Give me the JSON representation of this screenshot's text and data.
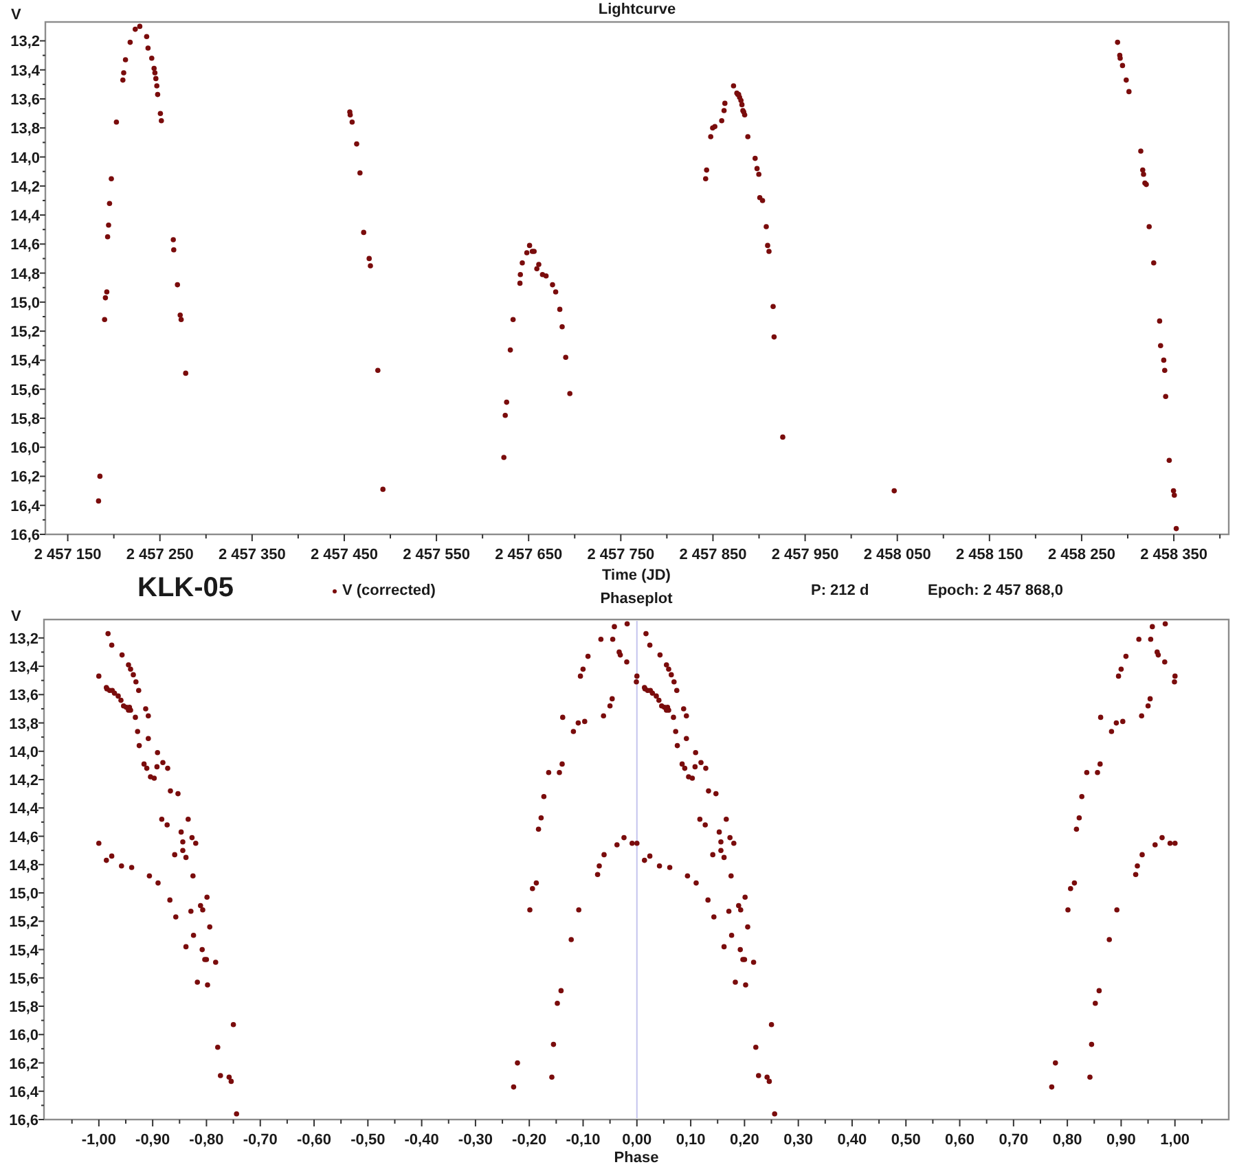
{
  "lightcurve": {
    "chart_data": {
      "type": "scatter",
      "title": "Lightcurve",
      "xlabel": "Time (JD)",
      "ylabel": "V",
      "xlim": [
        2457125.7,
        2458409.6
      ],
      "ylim": [
        16.6,
        13.07
      ],
      "xticks": [
        {
          "value": 2457150,
          "label": "2 457 150"
        },
        {
          "value": 2457250,
          "label": "2 457 250"
        },
        {
          "value": 2457350,
          "label": "2 457 350"
        },
        {
          "value": 2457450,
          "label": "2 457 450"
        },
        {
          "value": 2457550,
          "label": "2 457 550"
        },
        {
          "value": 2457650,
          "label": "2 457 650"
        },
        {
          "value": 2457750,
          "label": "2 457 750"
        },
        {
          "value": 2457850,
          "label": "2 457 850"
        },
        {
          "value": 2457950,
          "label": "2 457 950"
        },
        {
          "value": 2458050,
          "label": "2 458 050"
        },
        {
          "value": 2458150,
          "label": "2 458 150"
        },
        {
          "value": 2458250,
          "label": "2 458 250"
        },
        {
          "value": 2458350,
          "label": "2 458 350"
        }
      ],
      "yticks": [
        {
          "value": 13.2,
          "label": "13,2"
        },
        {
          "value": 13.4,
          "label": "13,4"
        },
        {
          "value": 13.6,
          "label": "13,6"
        },
        {
          "value": 13.8,
          "label": "13,8"
        },
        {
          "value": 14.0,
          "label": "14,0"
        },
        {
          "value": 14.2,
          "label": "14,2"
        },
        {
          "value": 14.4,
          "label": "14,4"
        },
        {
          "value": 14.6,
          "label": "14,6"
        },
        {
          "value": 14.8,
          "label": "14,8"
        },
        {
          "value": 15.0,
          "label": "15,0"
        },
        {
          "value": 15.2,
          "label": "15,2"
        },
        {
          "value": 15.4,
          "label": "15,4"
        },
        {
          "value": 15.6,
          "label": "15,6"
        },
        {
          "value": 15.8,
          "label": "15,8"
        },
        {
          "value": 16.0,
          "label": "16,0"
        },
        {
          "value": 16.2,
          "label": "16,2"
        },
        {
          "value": 16.4,
          "label": "16,4"
        },
        {
          "value": 16.6,
          "label": "16,6"
        }
      ],
      "series": [
        {
          "name": "V (corrected)",
          "color": "#7a0c0c",
          "x": [
            2457183.4,
            2457184.9,
            2457189.9,
            2457190.8,
            2457192.3,
            2457193.3,
            2457194.3,
            2457195.3,
            2457197.3,
            2457202.8,
            2457209.8,
            2457210.7,
            2457212.7,
            2457217.7,
            2457223.2,
            2457228.2,
            2457235.6,
            2457237.1,
            2457241.1,
            2457243.6,
            2457244.6,
            2457245.6,
            2457246.6,
            2457247.6,
            2457250.5,
            2457251.5,
            2457264.5,
            2457265.0,
            2457269.0,
            2457272.0,
            2457273.0,
            2457277.9,
            2457456.0,
            2457456.5,
            2457458.5,
            2457463.5,
            2457467.0,
            2457471.0,
            2457477.0,
            2457478.4,
            2457486.4,
            2457491.9,
            2457623.2,
            2457624.7,
            2457626.2,
            2457630.2,
            2457633.1,
            2457640.6,
            2457641.1,
            2457643.1,
            2457648.1,
            2457651.0,
            2457654.0,
            2457656.0,
            2457659.0,
            2457661.0,
            2457665.0,
            2457668.9,
            2457675.9,
            2457679.4,
            2457683.9,
            2457686.4,
            2457690.3,
            2457694.8,
            2457842.1,
            2457843.1,
            2457847.6,
            2457849.6,
            2457852.0,
            2457859.5,
            2457862.0,
            2457863.0,
            2457872.4,
            2457875.9,
            2457876.9,
            2457877.9,
            2457878.9,
            2457880.4,
            2457881.4,
            2457882.4,
            2457883.4,
            2457884.4,
            2457887.9,
            2457895.8,
            2457897.8,
            2457899.8,
            2457900.8,
            2457903.8,
            2457907.8,
            2457909.3,
            2457910.8,
            2457915.3,
            2457916.3,
            2457925.7,
            2458046.6,
            2458288.9,
            2458291.3,
            2458291.8,
            2458294.3,
            2458298.3,
            2458301.3,
            2458314.2,
            2458316.2,
            2458317.2,
            2458318.7,
            2458320.2,
            2458323.2,
            2458328.2,
            2458334.6,
            2458335.6,
            2458339.1,
            2458340.1,
            2458341.1,
            2458345.1,
            2458349.6,
            2458350.6,
            2458352.6
          ],
          "values": [
            16.37,
            16.2,
            15.12,
            14.97,
            14.93,
            14.55,
            14.47,
            14.32,
            14.15,
            13.76,
            13.47,
            13.42,
            13.33,
            13.21,
            13.12,
            13.1,
            13.17,
            13.25,
            13.32,
            13.39,
            13.42,
            13.46,
            13.51,
            13.57,
            13.7,
            13.75,
            14.57,
            14.64,
            14.88,
            15.09,
            15.12,
            15.49,
            13.69,
            13.71,
            13.76,
            13.91,
            14.11,
            14.52,
            14.7,
            14.75,
            15.47,
            16.29,
            16.07,
            15.78,
            15.69,
            15.33,
            15.12,
            14.87,
            14.81,
            14.73,
            14.66,
            14.61,
            14.65,
            14.65,
            14.77,
            14.74,
            14.81,
            14.82,
            14.88,
            14.93,
            15.05,
            15.17,
            15.38,
            15.63,
            14.15,
            14.09,
            13.86,
            13.8,
            13.79,
            13.75,
            13.68,
            13.63,
            13.51,
            13.56,
            13.57,
            13.57,
            13.59,
            13.61,
            13.64,
            13.68,
            13.69,
            13.71,
            13.86,
            14.01,
            14.08,
            14.12,
            14.28,
            14.3,
            14.48,
            14.61,
            14.65,
            15.03,
            15.24,
            15.93,
            16.3,
            13.21,
            13.3,
            13.32,
            13.37,
            13.47,
            13.55,
            13.96,
            14.09,
            14.12,
            14.18,
            14.19,
            14.48,
            14.73,
            15.13,
            15.3,
            15.4,
            15.47,
            15.65,
            16.09,
            16.3,
            16.33,
            16.56
          ]
        }
      ]
    }
  },
  "object": "KLK-05",
  "period": "P: 212 d",
  "epoch": "Epoch: 2 457 868,0",
  "phaseplot": {
    "chart_data": {
      "type": "scatter",
      "title": "Phaseplot",
      "xlabel": "Phase",
      "ylabel": "V",
      "xlim": [
        -1.102,
        1.1
      ],
      "ylim": [
        16.6,
        13.07
      ],
      "xticks": [
        {
          "value": -1.0,
          "label": "-1,00"
        },
        {
          "value": -0.9,
          "label": "-0,90"
        },
        {
          "value": -0.8,
          "label": "-0,80"
        },
        {
          "value": -0.7,
          "label": "-0,70"
        },
        {
          "value": -0.6,
          "label": "-0,60"
        },
        {
          "value": -0.5,
          "label": "-0,50"
        },
        {
          "value": -0.4,
          "label": "-0,40"
        },
        {
          "value": -0.3,
          "label": "-0,30"
        },
        {
          "value": -0.2,
          "label": "-0,20"
        },
        {
          "value": -0.1,
          "label": "-0,10"
        },
        {
          "value": 0.0,
          "label": "0,00"
        },
        {
          "value": 0.1,
          "label": "0,10"
        },
        {
          "value": 0.2,
          "label": "0,20"
        },
        {
          "value": 0.3,
          "label": "0,30"
        },
        {
          "value": 0.4,
          "label": "0,40"
        },
        {
          "value": 0.5,
          "label": "0,50"
        },
        {
          "value": 0.6,
          "label": "0,60"
        },
        {
          "value": 0.7,
          "label": "0,70"
        },
        {
          "value": 0.8,
          "label": "0,80"
        },
        {
          "value": 0.9,
          "label": "0,90"
        },
        {
          "value": 1.0,
          "label": "1,00"
        }
      ],
      "yticks": [
        {
          "value": 13.2,
          "label": "13,2"
        },
        {
          "value": 13.4,
          "label": "13,4"
        },
        {
          "value": 13.6,
          "label": "13,6"
        },
        {
          "value": 13.8,
          "label": "13,8"
        },
        {
          "value": 14.0,
          "label": "14,0"
        },
        {
          "value": 14.2,
          "label": "14,2"
        },
        {
          "value": 14.4,
          "label": "14,4"
        },
        {
          "value": 14.6,
          "label": "14,6"
        },
        {
          "value": 14.8,
          "label": "14,8"
        },
        {
          "value": 15.0,
          "label": "15,0"
        },
        {
          "value": 15.2,
          "label": "15,2"
        },
        {
          "value": 15.4,
          "label": "15,4"
        },
        {
          "value": 15.6,
          "label": "15,6"
        },
        {
          "value": 15.8,
          "label": "15,8"
        },
        {
          "value": 16.0,
          "label": "16,0"
        },
        {
          "value": 16.2,
          "label": "16,2"
        },
        {
          "value": 16.4,
          "label": "16,4"
        },
        {
          "value": 16.6,
          "label": "16,6"
        }
      ],
      "ref_lines": [
        {
          "axis": "x",
          "value": 0.0
        }
      ],
      "series": [
        {
          "color": "#7a0c0c",
          "x": [
            -0.229,
            -0.222,
            -0.199,
            -0.194,
            -0.187,
            -0.183,
            -0.178,
            -0.173,
            -0.164,
            -0.138,
            -0.105,
            -0.1,
            -0.091,
            -0.067,
            -0.042,
            -0.018,
            0.017,
            0.024,
            0.043,
            0.055,
            0.059,
            0.064,
            0.069,
            0.074,
            0.087,
            0.092,
            0.153,
            0.156,
            0.175,
            0.189,
            0.193,
            0.217,
            0.057,
            0.059,
            0.068,
            0.092,
            0.108,
            0.127,
            0.156,
            0.162,
            0.2,
            0.226,
            -0.155,
            -0.148,
            -0.141,
            -0.122,
            -0.108,
            -0.073,
            -0.07,
            -0.061,
            -0.037,
            -0.024,
            -0.009,
            0.0,
            0.014,
            0.024,
            0.042,
            0.061,
            0.094,
            0.11,
            0.132,
            0.143,
            0.162,
            0.183,
            -0.144,
            -0.139,
            -0.118,
            -0.109,
            -0.097,
            -0.062,
            -0.05,
            -0.046,
            -0.001,
            0.015,
            0.02,
            0.025,
            0.029,
            0.036,
            0.041,
            0.046,
            0.051,
            0.055,
            0.072,
            0.109,
            0.119,
            0.128,
            0.133,
            0.147,
            0.166,
            0.173,
            0.18,
            0.201,
            0.206,
            0.25,
            -0.158,
            -0.045,
            -0.033,
            -0.031,
            -0.019,
            0.0,
            0.014,
            0.075,
            0.084,
            0.089,
            0.096,
            0.103,
            0.117,
            0.141,
            0.171,
            0.176,
            0.192,
            0.197,
            0.202,
            0.221,
            0.242,
            0.246,
            0.256,
            -0.983,
            -0.976,
            -0.957,
            -0.945,
            -0.941,
            -0.936,
            -0.931,
            -0.926,
            -0.913,
            -0.908,
            -0.847,
            -0.844,
            -0.825,
            -0.811,
            -0.807,
            -0.783,
            -0.943,
            -0.941,
            -0.932,
            -0.908,
            -0.892,
            -0.873,
            -0.844,
            -0.838,
            -0.8,
            -0.774,
            -1.0,
            -0.986,
            -0.976,
            -0.958,
            -0.939,
            -0.906,
            -0.89,
            -0.868,
            -0.857,
            -0.838,
            -0.817,
            -0.985,
            -0.98,
            -0.975,
            -0.971,
            -0.964,
            -0.959,
            -0.954,
            -0.949,
            -0.945,
            -0.928,
            -0.891,
            -0.881,
            -0.872,
            -0.867,
            -0.853,
            -0.834,
            -0.827,
            -0.82,
            -0.799,
            -0.794,
            -0.75,
            -1.0,
            -0.986,
            -0.925,
            -0.916,
            -0.911,
            -0.904,
            -0.897,
            -0.883,
            -0.859,
            -0.829,
            -0.824,
            -0.808,
            -0.803,
            -0.798,
            -0.779,
            -0.758,
            -0.754,
            -0.744,
            0.771,
            0.778,
            0.801,
            0.806,
            0.813,
            0.817,
            0.822,
            0.827,
            0.836,
            0.862,
            0.895,
            0.9,
            0.909,
            0.933,
            0.958,
            0.982,
            0.845,
            0.852,
            0.859,
            0.878,
            0.892,
            0.927,
            0.93,
            0.939,
            0.963,
            0.976,
            0.991,
            1.0,
            0.856,
            0.861,
            0.882,
            0.891,
            0.903,
            0.938,
            0.95,
            0.954,
            0.999,
            0.842,
            0.955,
            0.967,
            0.969,
            0.981,
            1.0
          ],
          "values": [
            16.37,
            16.2,
            15.12,
            14.97,
            14.93,
            14.55,
            14.47,
            14.32,
            14.15,
            13.76,
            13.47,
            13.42,
            13.33,
            13.21,
            13.12,
            13.1,
            13.17,
            13.25,
            13.32,
            13.39,
            13.42,
            13.46,
            13.51,
            13.57,
            13.7,
            13.75,
            14.57,
            14.64,
            14.88,
            15.09,
            15.12,
            15.49,
            13.69,
            13.71,
            13.76,
            13.91,
            14.11,
            14.52,
            14.7,
            14.75,
            15.47,
            16.29,
            16.07,
            15.78,
            15.69,
            15.33,
            15.12,
            14.87,
            14.81,
            14.73,
            14.66,
            14.61,
            14.65,
            14.65,
            14.77,
            14.74,
            14.81,
            14.82,
            14.88,
            14.93,
            15.05,
            15.17,
            15.38,
            15.63,
            14.15,
            14.09,
            13.86,
            13.8,
            13.79,
            13.75,
            13.68,
            13.63,
            13.51,
            13.56,
            13.57,
            13.57,
            13.59,
            13.61,
            13.64,
            13.68,
            13.69,
            13.71,
            13.86,
            14.01,
            14.08,
            14.12,
            14.28,
            14.3,
            14.48,
            14.61,
            14.65,
            15.03,
            15.24,
            15.93,
            16.3,
            13.21,
            13.3,
            13.32,
            13.37,
            13.47,
            13.55,
            13.96,
            14.09,
            14.12,
            14.18,
            14.19,
            14.48,
            14.73,
            15.13,
            15.3,
            15.4,
            15.47,
            15.65,
            16.09,
            16.3,
            16.33,
            16.56,
            13.17,
            13.25,
            13.32,
            13.39,
            13.42,
            13.46,
            13.51,
            13.57,
            13.7,
            13.75,
            14.57,
            14.64,
            14.88,
            15.09,
            15.12,
            15.49,
            13.69,
            13.71,
            13.76,
            13.91,
            14.11,
            14.52,
            14.7,
            14.75,
            15.47,
            16.29,
            14.65,
            14.77,
            14.74,
            14.81,
            14.82,
            14.88,
            14.93,
            15.05,
            15.17,
            15.38,
            15.63,
            13.56,
            13.57,
            13.57,
            13.59,
            13.61,
            13.64,
            13.68,
            13.69,
            13.71,
            13.86,
            14.01,
            14.08,
            14.12,
            14.28,
            14.3,
            14.48,
            14.61,
            14.65,
            15.03,
            15.24,
            15.93,
            13.47,
            13.55,
            13.96,
            14.09,
            14.12,
            14.18,
            14.19,
            14.48,
            14.73,
            15.13,
            15.3,
            15.4,
            15.47,
            15.65,
            16.09,
            16.3,
            16.33,
            16.56,
            16.37,
            16.2,
            15.12,
            14.97,
            14.93,
            14.55,
            14.47,
            14.32,
            14.15,
            13.76,
            13.47,
            13.42,
            13.33,
            13.21,
            13.12,
            13.1,
            16.07,
            15.78,
            15.69,
            15.33,
            15.12,
            14.87,
            14.81,
            14.73,
            14.66,
            14.61,
            14.65,
            14.65,
            14.15,
            14.09,
            13.86,
            13.8,
            13.79,
            13.75,
            13.68,
            13.63,
            13.51,
            16.3,
            13.21,
            13.3,
            13.32,
            13.37,
            13.47
          ]
        }
      ]
    }
  }
}
